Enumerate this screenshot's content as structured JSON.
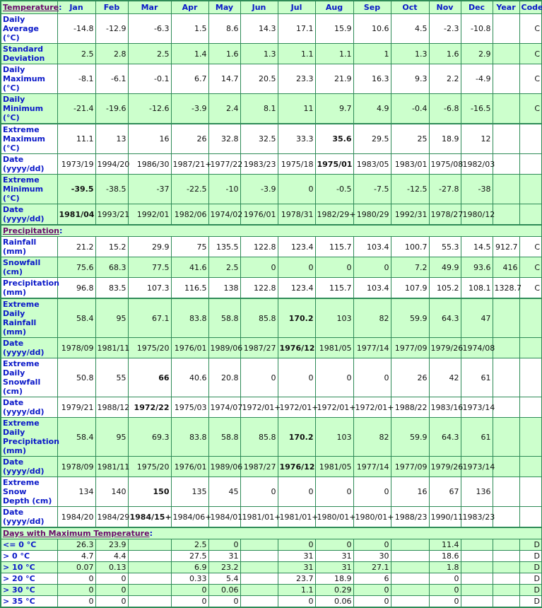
{
  "columns": [
    "Jan",
    "Feb",
    "Mar",
    "Apr",
    "May",
    "Jun",
    "Jul",
    "Aug",
    "Sep",
    "Oct",
    "Nov",
    "Dec",
    "Year",
    "Code"
  ],
  "sections": {
    "temperature": "Temperature",
    "precipitation": "Precipitation",
    "days_max_temp": "Days with Maximum Temperature"
  },
  "colon": ":",
  "temperature_rows": [
    {
      "label": "Daily Average (°C)",
      "values": [
        "-14.8",
        "-12.9",
        "-6.3",
        "1.5",
        "8.6",
        "14.3",
        "17.1",
        "15.9",
        "10.6",
        "4.5",
        "-2.3",
        "-10.8",
        "",
        "C"
      ],
      "bold": []
    },
    {
      "label": "Standard Deviation",
      "values": [
        "2.5",
        "2.8",
        "2.5",
        "1.4",
        "1.6",
        "1.3",
        "1.1",
        "1.1",
        "1",
        "1.3",
        "1.6",
        "2.9",
        "",
        "C"
      ],
      "bold": []
    },
    {
      "label": "Daily Maximum (°C)",
      "values": [
        "-8.1",
        "-6.1",
        "-0.1",
        "6.7",
        "14.7",
        "20.5",
        "23.3",
        "21.9",
        "16.3",
        "9.3",
        "2.2",
        "-4.9",
        "",
        "C"
      ],
      "bold": []
    },
    {
      "label": "Daily Minimum (°C)",
      "values": [
        "-21.4",
        "-19.6",
        "-12.6",
        "-3.9",
        "2.4",
        "8.1",
        "11",
        "9.7",
        "4.9",
        "-0.4",
        "-6.8",
        "-16.5",
        "",
        "C"
      ],
      "bold": []
    },
    {
      "label": "Extreme Maximum (°C)",
      "values": [
        "11.1",
        "13",
        "16",
        "26",
        "32.8",
        "32.5",
        "33.3",
        "35.6",
        "29.5",
        "25",
        "18.9",
        "12",
        "",
        ""
      ],
      "bold": [
        7
      ]
    },
    {
      "label": "Date (yyyy/dd)",
      "values": [
        "1973/19",
        "1994/20",
        "1986/30",
        "1987/21+",
        "1977/22",
        "1983/23",
        "1975/18",
        "1975/01",
        "1983/05",
        "1983/01",
        "1975/08",
        "1982/03",
        "",
        ""
      ],
      "bold": [
        7
      ]
    },
    {
      "label": "Extreme Minimum (°C)",
      "values": [
        "-39.5",
        "-38.5",
        "-37",
        "-22.5",
        "-10",
        "-3.9",
        "0",
        "-0.5",
        "-7.5",
        "-12.5",
        "-27.8",
        "-38",
        "",
        ""
      ],
      "bold": [
        0
      ]
    },
    {
      "label": "Date (yyyy/dd)",
      "values": [
        "1981/04",
        "1993/21",
        "1992/01",
        "1982/06",
        "1974/02",
        "1976/01",
        "1978/31",
        "1982/29+",
        "1980/29",
        "1992/31",
        "1978/27",
        "1980/12",
        "",
        ""
      ],
      "bold": [
        0
      ]
    }
  ],
  "precipitation_rows": [
    {
      "label": "Rainfall (mm)",
      "values": [
        "21.2",
        "15.2",
        "29.9",
        "75",
        "135.5",
        "122.8",
        "123.4",
        "115.7",
        "103.4",
        "100.7",
        "55.3",
        "14.5",
        "912.7",
        "C"
      ],
      "bold": []
    },
    {
      "label": "Snowfall (cm)",
      "values": [
        "75.6",
        "68.3",
        "77.5",
        "41.6",
        "2.5",
        "0",
        "0",
        "0",
        "0",
        "7.2",
        "49.9",
        "93.6",
        "416",
        "C"
      ],
      "bold": []
    },
    {
      "label": "Precipitation (mm)",
      "values": [
        "96.8",
        "83.5",
        "107.3",
        "116.5",
        "138",
        "122.8",
        "123.4",
        "115.7",
        "103.4",
        "107.9",
        "105.2",
        "108.1",
        "1328.7",
        "C"
      ],
      "bold": []
    },
    {
      "label": "Extreme Daily Rainfall (mm)",
      "values": [
        "58.4",
        "95",
        "67.1",
        "83.8",
        "58.8",
        "85.8",
        "170.2",
        "103",
        "82",
        "59.9",
        "64.3",
        "47",
        "",
        ""
      ],
      "bold": [
        6
      ]
    },
    {
      "label": "Date (yyyy/dd)",
      "values": [
        "1978/09",
        "1981/11",
        "1975/20",
        "1976/01",
        "1989/06",
        "1987/27",
        "1976/12",
        "1981/05",
        "1977/14",
        "1977/09",
        "1979/26",
        "1974/08",
        "",
        ""
      ],
      "bold": [
        6
      ]
    },
    {
      "label": "Extreme Daily Snowfall (cm)",
      "values": [
        "50.8",
        "55",
        "66",
        "40.6",
        "20.8",
        "0",
        "0",
        "0",
        "0",
        "26",
        "42",
        "61",
        "",
        ""
      ],
      "bold": [
        2
      ]
    },
    {
      "label": "Date (yyyy/dd)",
      "values": [
        "1979/21",
        "1988/12",
        "1972/22",
        "1975/03",
        "1974/07",
        "1972/01+",
        "1972/01+",
        "1972/01+",
        "1972/01+",
        "1988/22",
        "1983/16",
        "1973/14",
        "",
        ""
      ],
      "bold": [
        2
      ]
    },
    {
      "label": "Extreme Daily Precipitation (mm)",
      "values": [
        "58.4",
        "95",
        "69.3",
        "83.8",
        "58.8",
        "85.8",
        "170.2",
        "103",
        "82",
        "59.9",
        "64.3",
        "61",
        "",
        ""
      ],
      "bold": [
        6
      ]
    },
    {
      "label": "Date (yyyy/dd)",
      "values": [
        "1978/09",
        "1981/11",
        "1975/20",
        "1976/01",
        "1989/06",
        "1987/27",
        "1976/12",
        "1981/05",
        "1977/14",
        "1977/09",
        "1979/26",
        "1973/14",
        "",
        ""
      ],
      "bold": [
        6
      ]
    },
    {
      "label": "Extreme Snow Depth (cm)",
      "values": [
        "134",
        "140",
        "150",
        "135",
        "45",
        "0",
        "0",
        "0",
        "0",
        "16",
        "67",
        "136",
        "",
        ""
      ],
      "bold": [
        2
      ]
    },
    {
      "label": "Date (yyyy/dd)",
      "values": [
        "1984/20",
        "1984/29",
        "1984/15+",
        "1984/06+",
        "1984/01",
        "1981/01+",
        "1981/01+",
        "1980/01+",
        "1980/01+",
        "1988/23",
        "1990/11",
        "1983/23",
        "",
        ""
      ],
      "bold": [
        2
      ]
    }
  ],
  "days_rows": [
    {
      "label": "<= 0 °C",
      "values": [
        "26.3",
        "23.9",
        "",
        "2.5",
        "0",
        "",
        "0",
        "0",
        "0",
        "",
        "11.4",
        "",
        "",
        "D"
      ],
      "bold": []
    },
    {
      "label": "> 0 °C",
      "values": [
        "4.7",
        "4.4",
        "",
        "27.5",
        "31",
        "",
        "31",
        "31",
        "30",
        "",
        "18.6",
        "",
        "",
        "D"
      ],
      "bold": []
    },
    {
      "label": "> 10 °C",
      "values": [
        "0.07",
        "0.13",
        "",
        "6.9",
        "23.2",
        "",
        "31",
        "31",
        "27.1",
        "",
        "1.8",
        "",
        "",
        "D"
      ],
      "bold": []
    },
    {
      "label": "> 20 °C",
      "values": [
        "0",
        "0",
        "",
        "0.33",
        "5.4",
        "",
        "23.7",
        "18.9",
        "6",
        "",
        "0",
        "",
        "",
        "D"
      ],
      "bold": []
    },
    {
      "label": "> 30 °C",
      "values": [
        "0",
        "0",
        "",
        "0",
        "0.06",
        "",
        "1.1",
        "0.29",
        "0",
        "",
        "0",
        "",
        "",
        "D"
      ],
      "bold": []
    },
    {
      "label": "> 35 °C",
      "values": [
        "0",
        "0",
        "",
        "0",
        "0",
        "",
        "0",
        "0.06",
        "0",
        "",
        "0",
        "",
        "",
        "D"
      ],
      "bold": []
    }
  ]
}
